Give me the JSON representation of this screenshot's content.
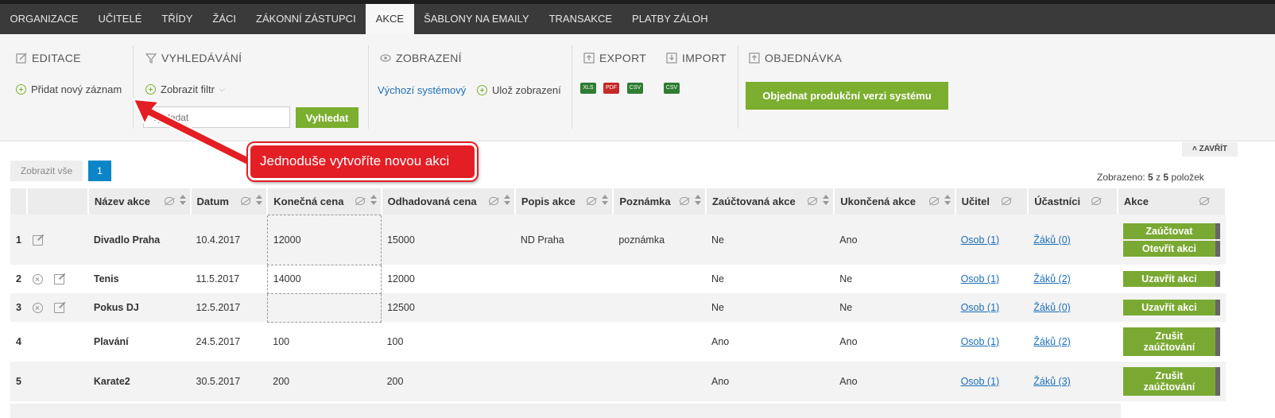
{
  "nav": {
    "tabs": [
      {
        "label": "ORGANIZACE",
        "active": false
      },
      {
        "label": "UČITELÉ",
        "active": false
      },
      {
        "label": "TŘÍDY",
        "active": false
      },
      {
        "label": "ŽÁCI",
        "active": false
      },
      {
        "label": "ZÁKONNÍ ZÁSTUPCI",
        "active": false
      },
      {
        "label": "AKCE",
        "active": true
      },
      {
        "label": "ŠABLONY NA EMAILY",
        "active": false
      },
      {
        "label": "TRANSAKCE",
        "active": false
      },
      {
        "label": "PLATBY ZÁLOH",
        "active": false
      }
    ]
  },
  "toolbar": {
    "editace": {
      "title": "EDITACE",
      "add_label": "Přidat nový záznam"
    },
    "vyhledavani": {
      "title": "VYHLEDÁVÁNÍ",
      "filter_label": "Zobrazit filtr",
      "search_placeholder": "Vyhledat",
      "search_button": "Vyhledat"
    },
    "zobrazeni": {
      "title": "ZOBRAZENÍ",
      "default_view": "Výchozí systémový",
      "save_view": "Ulož zobrazení"
    },
    "export": {
      "title": "EXPORT",
      "formats": [
        "XLS",
        "PDF",
        "CSV"
      ]
    },
    "import": {
      "title": "IMPORT",
      "formats": [
        "CSV"
      ]
    },
    "objednavka": {
      "title": "OBJEDNÁVKA",
      "order_button": "Objednat produkční verzi systému"
    }
  },
  "pagination": {
    "show_all": "Zobrazit vše",
    "current_page": "1"
  },
  "close_label": "ZAVŘÍT",
  "count": {
    "prefix": "Zobrazeno: ",
    "shown": "5",
    "middle": " z ",
    "total": "5",
    "suffix": " položek"
  },
  "callout": {
    "text": "Jednoduše vytvoříte novou akci"
  },
  "table": {
    "headers": [
      "Název akce",
      "Datum",
      "Konečná cena",
      "Odhadovaná cena",
      "Popis akce",
      "Poznámka",
      "Zaúčtovaná akce",
      "Ukončená akce",
      "Učitel",
      "Účastníci",
      "Akce"
    ],
    "rows": [
      {
        "num": "1",
        "name": "Divadlo Praha",
        "date": "10.4.2017",
        "final_price": "12000",
        "est_price": "15000",
        "desc": "ND Praha",
        "note": "poznámka",
        "booked": "Ne",
        "ended": "Ano",
        "teacher": "Osob (1)",
        "participants": "Žáků (0)",
        "actions": [
          "Zaúčtovat",
          "Otevřít akci"
        ]
      },
      {
        "num": "2",
        "name": "Tenis",
        "date": "11.5.2017",
        "final_price": "14000",
        "est_price": "12000",
        "desc": "",
        "note": "",
        "booked": "Ne",
        "ended": "Ne",
        "teacher": "Osob (1)",
        "participants": "Žáků (2)",
        "actions": [
          "Uzavřít akci"
        ]
      },
      {
        "num": "3",
        "name": "Pokus DJ",
        "date": "12.5.2017",
        "final_price": "",
        "est_price": "12500",
        "desc": "",
        "note": "",
        "booked": "Ne",
        "ended": "Ne",
        "teacher": "Osob (1)",
        "participants": "Žáků (0)",
        "actions": [
          "Uzavřít akci"
        ]
      },
      {
        "num": "4",
        "name": "Plavání",
        "date": "24.5.2017",
        "final_price": "100",
        "est_price": "100",
        "desc": "",
        "note": "",
        "booked": "Ano",
        "ended": "Ano",
        "teacher": "Osob (1)",
        "participants": "Žáků (2)",
        "actions": [
          "Zrušit zaúčtování"
        ]
      },
      {
        "num": "5",
        "name": "Karate2",
        "date": "30.5.2017",
        "final_price": "200",
        "est_price": "200",
        "desc": "",
        "note": "",
        "booked": "Ano",
        "ended": "Ano",
        "teacher": "Osob (1)",
        "participants": "Žáků (3)",
        "actions": [
          "Zrušit zaúčtování"
        ]
      }
    ]
  },
  "colors": {
    "accent_green": "#7cae2f",
    "nav_bg": "#3a3a3a",
    "callout_red": "#e31e24",
    "page_blue": "#0a85c7"
  }
}
